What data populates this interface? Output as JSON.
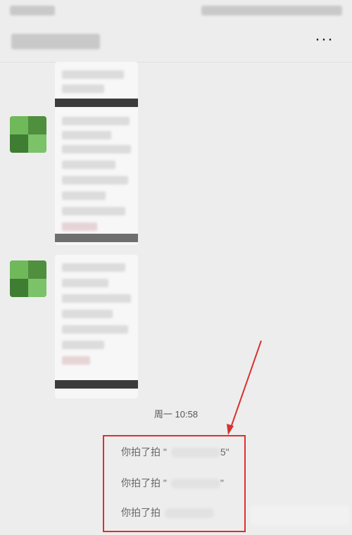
{
  "header": {
    "more_icon": "more-icon",
    "more_label": "···"
  },
  "chat": {
    "timestamp": "周一 10:58"
  },
  "pats": [
    {
      "prefix": "你拍了拍 \"",
      "suffix": "5\""
    },
    {
      "prefix": "你拍了拍 \"",
      "suffix": "\""
    },
    {
      "prefix": "你拍了拍",
      "suffix": ""
    }
  ],
  "annotation": {
    "color": "#d9312f"
  }
}
